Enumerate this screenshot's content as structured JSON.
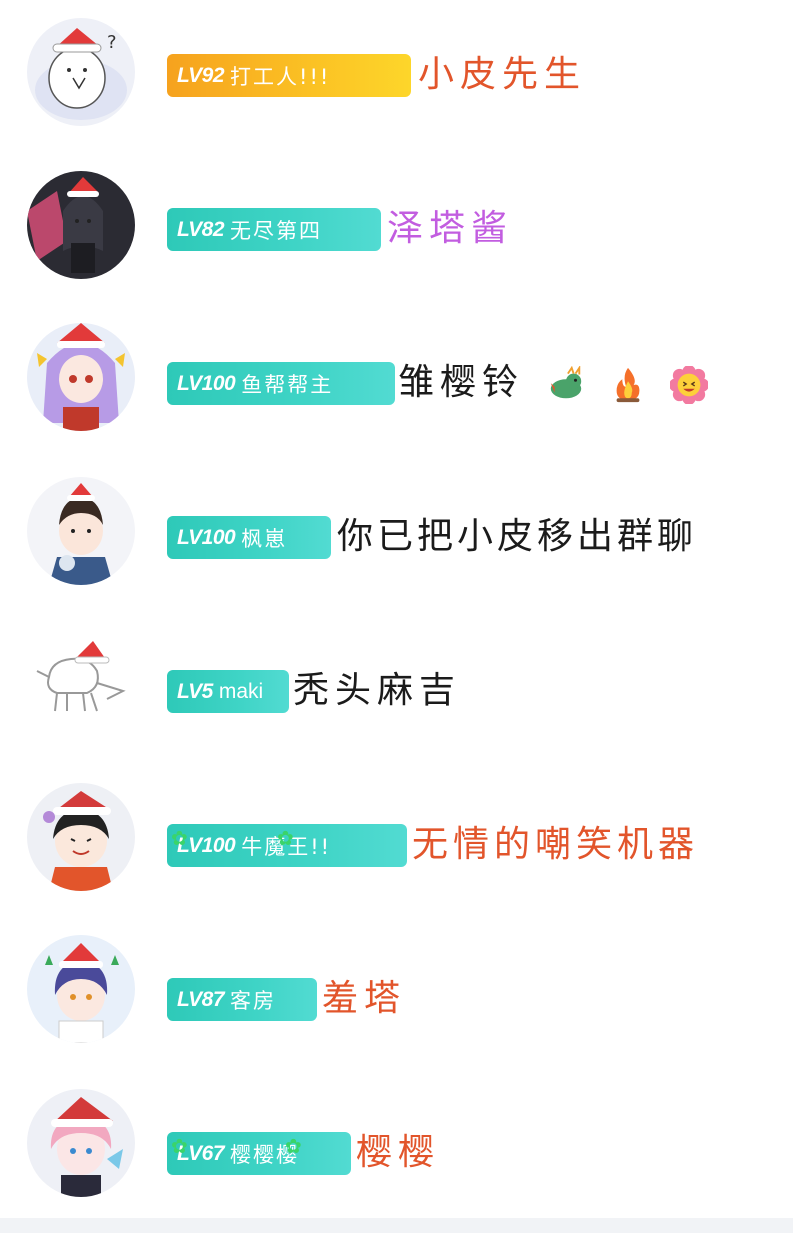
{
  "members": [
    {
      "level": "LV92",
      "title": "打工人!!!",
      "nickname": "小皮先生",
      "badge_style": "orange",
      "nick_color": "#e2552b"
    },
    {
      "level": "LV82",
      "title": "无尽第四",
      "nickname": "泽塔酱",
      "badge_style": "teal",
      "nick_color": "#c25de0"
    },
    {
      "level": "LV100",
      "title": "鱼帮帮主",
      "nickname": "雏樱铃",
      "badge_style": "teal",
      "nick_color": "#1b1b1b",
      "emojis": [
        "dragon-icon",
        "fire-icon",
        "smiling-flower-icon"
      ]
    },
    {
      "level": "LV100",
      "title": "枫崽",
      "nickname": "你已把小皮移出群聊",
      "badge_style": "teal",
      "nick_color": "#1b1b1b"
    },
    {
      "level": "LV5",
      "title": "maki",
      "nickname": "秃头麻吉",
      "badge_style": "teal",
      "nick_color": "#1b1b1b"
    },
    {
      "level": "LV100",
      "title": "牛魔王!!",
      "nickname": "无情的嘲笑机器",
      "badge_style": "teal",
      "nick_color": "#e2552b"
    },
    {
      "level": "LV87",
      "title": "客房",
      "nickname": "羞塔",
      "badge_style": "teal",
      "nick_color": "#e2552b"
    },
    {
      "level": "LV67",
      "title": "樱樱樱",
      "nickname": "樱樱",
      "badge_style": "teal",
      "nick_color": "#e2552b"
    }
  ],
  "colors": {
    "orange_badge": "#f6a21e",
    "teal_badge": "#2ec9b8",
    "background": "#ffffff"
  }
}
